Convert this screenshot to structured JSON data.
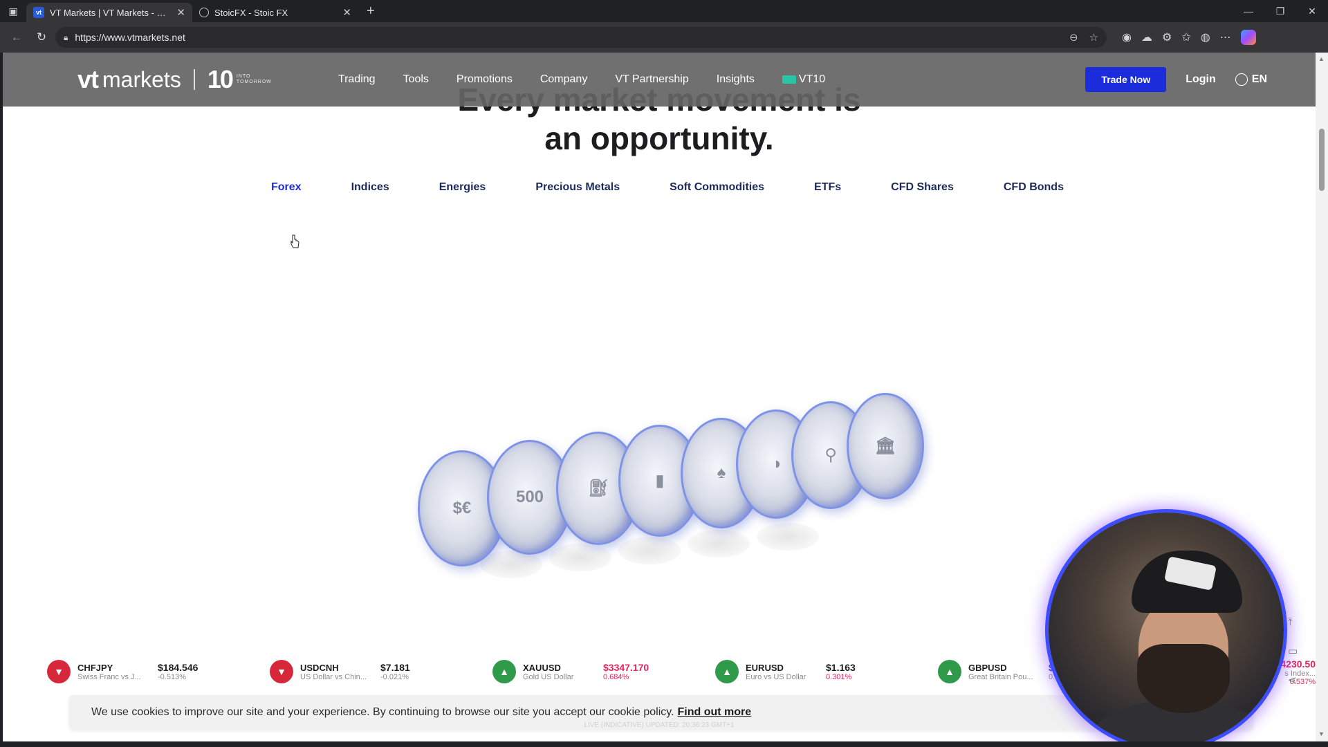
{
  "browser": {
    "tabs": [
      {
        "title": "VT Markets | VT Markets - Reliab",
        "favicon": "vt",
        "active": true
      },
      {
        "title": "StoicFX - Stoic FX",
        "favicon": "globe",
        "active": false
      }
    ],
    "url": "https://www.vtmarkets.net"
  },
  "header": {
    "logo_vt": "vt",
    "logo_markets": "markets",
    "logo_10": "10",
    "logo_tagline_1": "INTO",
    "logo_tagline_2": "TOMORROW",
    "menu": [
      "Trading",
      "Tools",
      "Promotions",
      "Company",
      "VT Partnership",
      "Insights"
    ],
    "vt10_label": "VT10",
    "trade_now": "Trade Now",
    "login": "Login",
    "language": "EN"
  },
  "hero": {
    "title_line1": "Every market movement is",
    "title_line2": "an opportunity."
  },
  "categories": [
    "Forex",
    "Indices",
    "Energies",
    "Precious Metals",
    "Soft Commodities",
    "ETFs",
    "CFD Shares",
    "CFD Bonds"
  ],
  "ticker": [
    {
      "symbol": "CHFJPY",
      "desc": "Swiss Franc vs J...",
      "price": "$184.546",
      "change": "-0.513%",
      "direction": "down",
      "price_color": "dark",
      "change_color": "grey"
    },
    {
      "symbol": "USDCNH",
      "desc": "US Dollar vs Chin...",
      "price": "$7.181",
      "change": "-0.021%",
      "direction": "down",
      "price_color": "dark",
      "change_color": "grey"
    },
    {
      "symbol": "XAUUSD",
      "desc": "Gold US Dollar",
      "price": "$3347.170",
      "change": "0.684%",
      "direction": "up",
      "price_color": "pink",
      "change_color": "pink"
    },
    {
      "symbol": "EURUSD",
      "desc": "Euro vs US Dollar",
      "price": "$1.163",
      "change": "0.301%",
      "direction": "up",
      "price_color": "dark",
      "change_color": "pink"
    },
    {
      "symbol": "GBPUSD",
      "desc": "Great Britain Pou...",
      "price": "$1.341",
      "change": "0.235%",
      "direction": "up",
      "price_color": "blue",
      "change_color": "grey"
    }
  ],
  "ticker_partial": {
    "price": "$44230.50",
    "desc": "s Index...",
    "change": "0.537%"
  },
  "cookie": {
    "text": "We use cookies to improve our site and your experience. By continuing to browse our site you accept our cookie policy.",
    "link": "Find out more"
  },
  "updated_text": "LIVE (INDICATIVE) UPDATED: 20:36:23 GMT+1"
}
